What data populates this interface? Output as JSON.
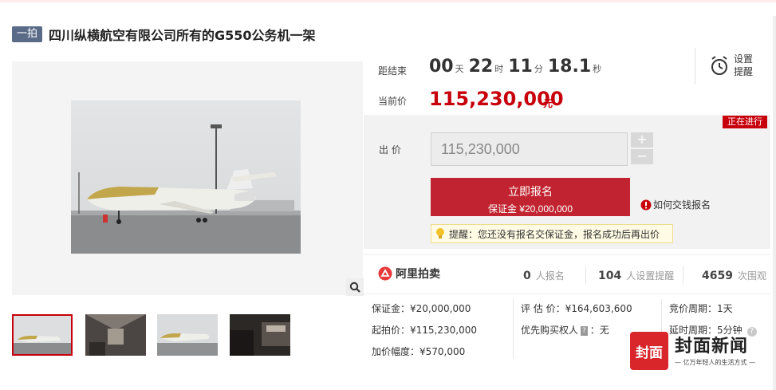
{
  "title": {
    "tag": "一拍",
    "text": "四川纵横航空有限公司所有的G550公务机一架"
  },
  "countdown": {
    "label": "距结束",
    "days": "00",
    "days_unit": "天",
    "hours": "22",
    "hours_unit": "时",
    "minutes": "11",
    "minutes_unit": "分",
    "seconds": "18.1",
    "seconds_unit": "秒"
  },
  "reminder": {
    "label": "设置提醒",
    "icon": "alarm-clock-icon"
  },
  "current_price": {
    "label": "当前价",
    "value": "115,230,000",
    "unit": "元"
  },
  "status_tag": "正在进行",
  "bid": {
    "label": "出 价",
    "value": "115,230,000",
    "plus": "+",
    "minus": "−",
    "button_title": "立即报名",
    "button_sub": "保证金 ¥20,000,000",
    "howto": "如何交钱报名",
    "tip": "提醒：您还没有报名交保证金，报名成功后再出价"
  },
  "stats": {
    "brand": "阿里拍卖",
    "signups": {
      "value": "0",
      "label": "人报名"
    },
    "reminders": {
      "value": "104",
      "label": "人设置提醒"
    },
    "views": {
      "value": "4659",
      "label": "次围观"
    }
  },
  "info": {
    "deposit": "保证金：¥20,000,000",
    "start_price": "起拍价：¥115,230,000",
    "increment": "加价幅度：¥570,000",
    "appraisal": "评 估 价：¥164,603,600",
    "priority_prefix": "优先购买权人",
    "priority_badge": "?",
    "priority_value": "：无",
    "period": "竞价周期：1天",
    "extension": "延时周期：5分钟"
  },
  "watermark": {
    "badge": "封面",
    "title": "封面新闻",
    "sub": "— 亿万年轻人的生活方式 —"
  },
  "colors": {
    "accent": "#c7000b",
    "button": "#c12430",
    "tag": "#5a6b88"
  }
}
